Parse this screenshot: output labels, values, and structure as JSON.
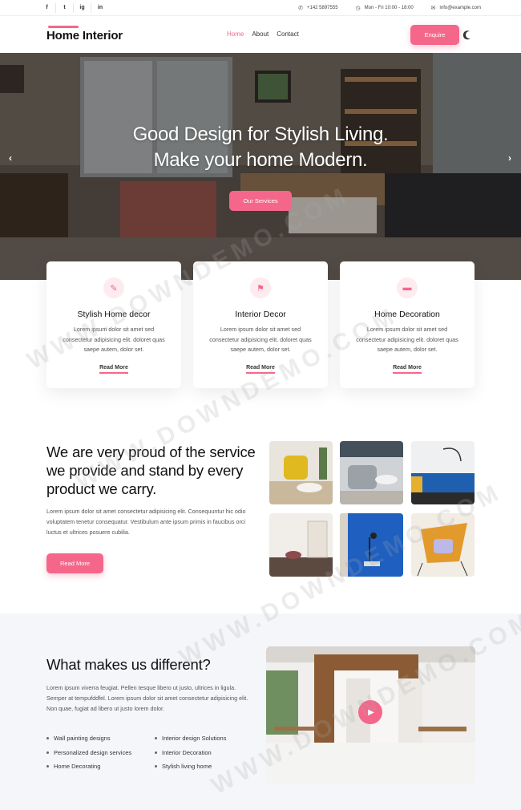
{
  "topbar": {
    "social": [
      "f",
      "t",
      "ig",
      "in"
    ],
    "phone": "+142 5897555",
    "hours": "Mon - Fri 10:00 - 18:00",
    "email": "info@example.com"
  },
  "nav": {
    "logo": "Home Interior",
    "menu": [
      "Home",
      "About",
      "Contact"
    ],
    "enquire": "Enquire"
  },
  "hero": {
    "line1": "Good Design for Stylish Living.",
    "line2": "Make your home Modern.",
    "button": "Our Services"
  },
  "cards": [
    {
      "title": "Stylish Home decor",
      "text": "Lorem ipsum dolor sit amet sed consectetur adipisicing elit. doloret quas saepe autem, dolor set.",
      "link": "Read More",
      "icon": "edit-icon"
    },
    {
      "title": "Interior Decor",
      "text": "Lorem ipsum dolor sit amet sed consectetur adipisicing elit. doloret quas saepe autem, dolor set.",
      "link": "Read More",
      "icon": "paint-roller-icon"
    },
    {
      "title": "Home Decoration",
      "text": "Lorem ipsum dolor sit amet sed consectetur adipisicing elit. doloret quas saepe autem, dolor set.",
      "link": "Read More",
      "icon": "bed-icon"
    }
  ],
  "about": {
    "title": "We are very proud of the service we provide and stand by every product we carry.",
    "text": "Lorem ipsum dolor sit amet consectetur adipisicing elit. Consequuntur hic odio voluptatem tenetur consequatur. Vestibulum ante ipsum primis in faucibus orci luctus et ultrices posuere cubilia.",
    "button": "Read More"
  },
  "different": {
    "title": "What makes us different?",
    "text": "Lorem ipsum viverra feugiat. Pellen tesque libero ut justo, ultrices in ligula. Semper at tempufddfel. Lorem ipsum dolor sit amet consectetur adipisicing elit. Non quae, fugiat ad libero ut justo lorem dolor.",
    "list_left": [
      "Wall painting designs",
      "Personalized design services",
      "Home Decorating"
    ],
    "list_right": [
      "Interior design Solutions",
      "Interior Decoration",
      "Stylish living home"
    ]
  },
  "watermark": "WWW.DOWNDEMO.COM",
  "colors": {
    "accent": "#f4678a"
  }
}
